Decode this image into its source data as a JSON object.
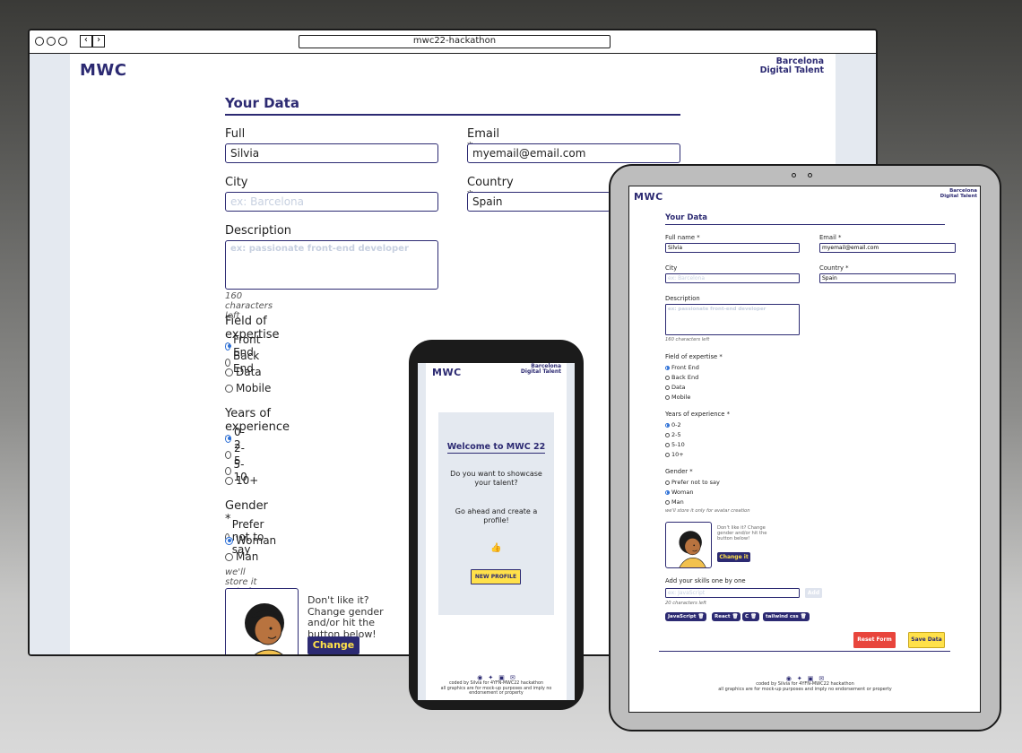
{
  "browser": {
    "url": "mwc22-hackathon"
  },
  "brand": {
    "logo": "MWC",
    "tagline_line1": "Barcelona",
    "tagline_line2": "Digital Talent"
  },
  "form": {
    "title": "Your Data",
    "full_name_label": "Full name *",
    "full_name_value": "Silvia",
    "email_label": "Email *",
    "email_value": "myemail@email.com",
    "city_label": "City",
    "city_placeholder": "ex: Barcelona",
    "country_label": "Country *",
    "country_value": "Spain",
    "description_label": "Description",
    "description_placeholder": "ex: passionate front-end developer",
    "description_counter": "160 characters left",
    "expertise_label": "Field of expertise *",
    "expertise_options": [
      "Front End",
      "Back End",
      "Data",
      "Mobile"
    ],
    "expertise_selected": "Front End",
    "experience_label": "Years of experience *",
    "experience_options": [
      "0-2",
      "2-5",
      "5-10",
      "10+"
    ],
    "experience_selected": "0-2",
    "gender_label": "Gender *",
    "gender_options": [
      "Prefer not to say",
      "Woman",
      "Man"
    ],
    "gender_selected": "Woman",
    "gender_hint": "we'll store it only for avatar creation",
    "avatar_hint": "Don't like it? Change gender and/or hit the button below!",
    "change_button": "Change it",
    "skills_label": "Add your skills one by one",
    "skills_placeholder": "ex: JavaScript",
    "skills_add_button": "Add",
    "skills_counter": "20 characters left",
    "skills": [
      "JavaScript",
      "React",
      "C",
      "tailwind css"
    ],
    "reset_button": "Reset Form",
    "save_button": "Save Data"
  },
  "welcome": {
    "title": "Welcome to MWC 22",
    "question": "Do you want to showcase your talent?",
    "cta_text": "Go ahead and create a profile!",
    "button": "NEW PROFILE"
  },
  "footer": {
    "credit": "coded by Silvia for 4YFN-MWC22 hackathon",
    "disclaimer": "all graphics are for mock-up purposes and imply no endorsement or property"
  },
  "colors": {
    "navy": "#2c2a72",
    "yellow": "#ffe14a",
    "side": "#e4e9f0",
    "reset": "#e8453c",
    "radio": "#2c6fd6"
  },
  "icons": {
    "like": "thumbs-up-icon",
    "social": [
      "github-icon",
      "twitter-icon",
      "linkedin-icon",
      "mail-icon"
    ]
  }
}
